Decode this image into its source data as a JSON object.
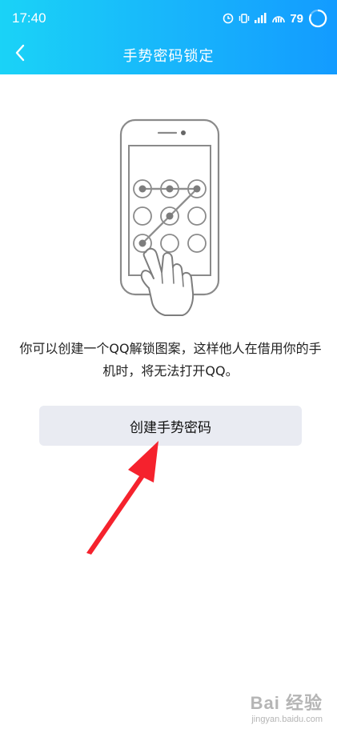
{
  "status_bar": {
    "time": "17:40",
    "battery": "79",
    "icons": [
      "alarm-icon",
      "vibrate-icon",
      "signal-icon",
      "hd-signal-icon",
      "battery-ring-icon"
    ]
  },
  "nav": {
    "back_icon": "chevron-left-icon",
    "title": "手势密码锁定"
  },
  "illustration": {
    "icon": "pattern-lock-phone-illustration",
    "grid": "3x3",
    "pattern_path": [
      "top-left",
      "top-center",
      "top-right",
      "middle-center",
      "bottom-left"
    ]
  },
  "description": "你可以创建一个QQ解锁图案，这样他人在借用你的手机时，将无法打开QQ。",
  "button": {
    "label": "创建手势密码"
  },
  "annotation": {
    "icon": "red-arrow-icon",
    "color": "#f5222d"
  },
  "watermark": {
    "brand": "Bai 经验",
    "url": "jingyan.baidu.com"
  },
  "colors": {
    "header_gradient_start": "#1ad3f7",
    "header_gradient_end": "#139bff",
    "button_bg": "#e9ebf2"
  }
}
